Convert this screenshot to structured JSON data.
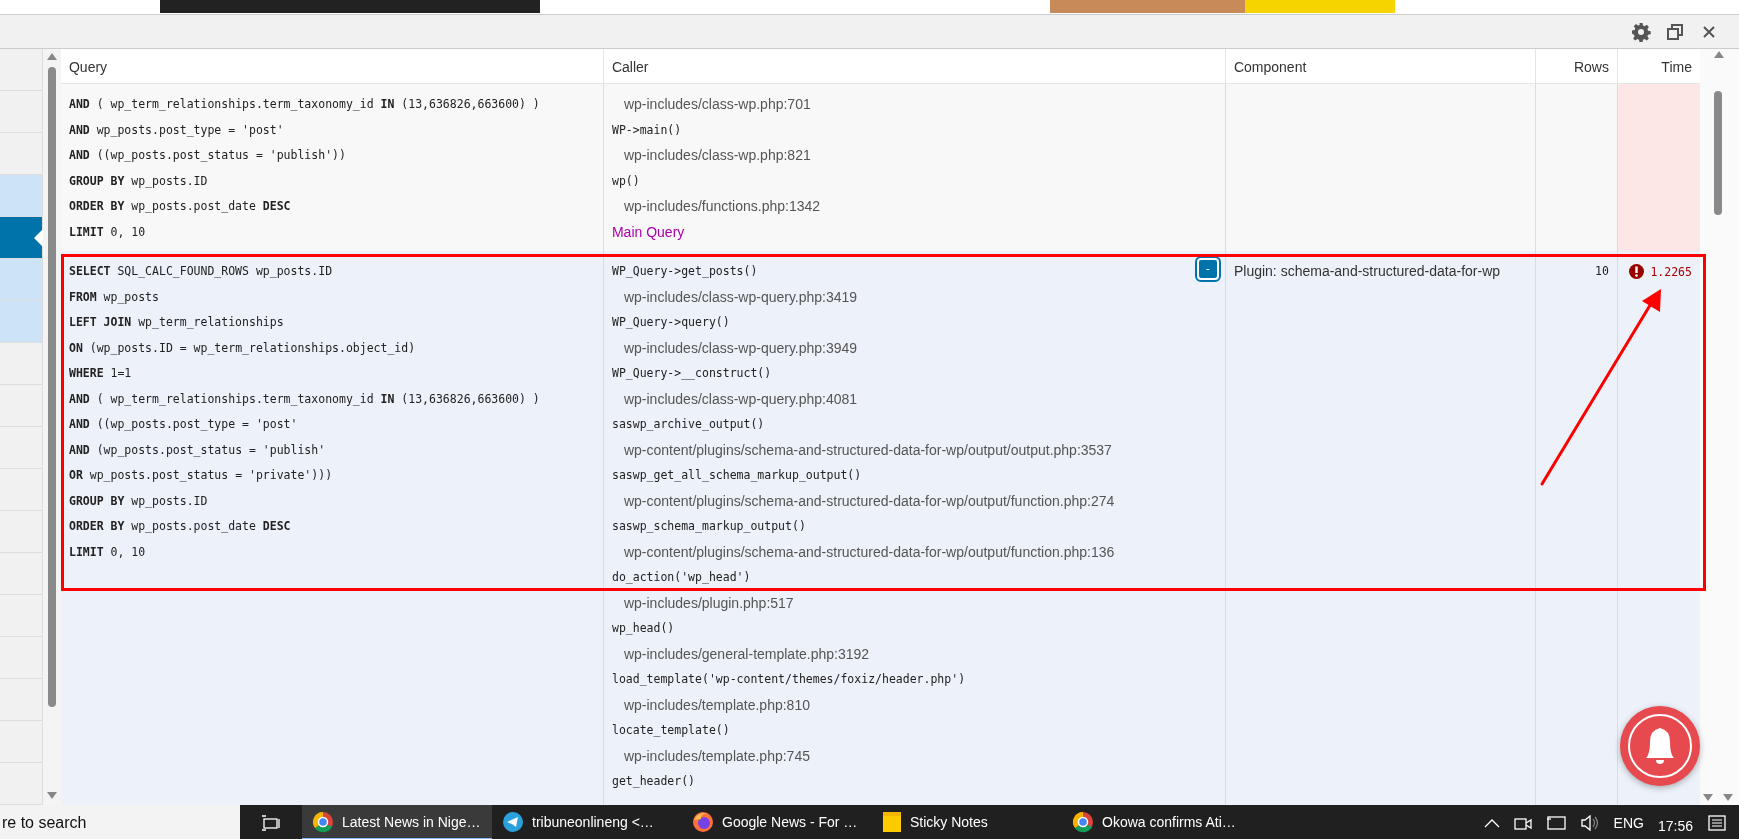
{
  "sidebar": {
    "items": [
      {
        "selected": false,
        "highlighted": false
      },
      {
        "selected": false,
        "highlighted": false
      },
      {
        "selected": false,
        "highlighted": false
      },
      {
        "selected": false,
        "highlighted": true
      },
      {
        "selected": true,
        "highlighted": false
      },
      {
        "selected": false,
        "highlighted": true
      },
      {
        "selected": false,
        "highlighted": true
      },
      {
        "selected": false,
        "highlighted": false
      },
      {
        "selected": false,
        "highlighted": false
      },
      {
        "selected": false,
        "highlighted": false
      },
      {
        "selected": false,
        "highlighted": false
      },
      {
        "selected": false,
        "highlighted": false
      },
      {
        "selected": false,
        "highlighted": false
      },
      {
        "selected": false,
        "highlighted": false
      },
      {
        "selected": false,
        "highlighted": false
      },
      {
        "selected": false,
        "highlighted": false
      },
      {
        "selected": false,
        "highlighted": false
      },
      {
        "selected": false,
        "highlighted": false
      }
    ]
  },
  "table": {
    "columns": [
      {
        "label": "Query"
      },
      {
        "label": "Caller"
      },
      {
        "label": "Component"
      },
      {
        "label": "Rows"
      },
      {
        "label": "Time"
      }
    ],
    "rows": [
      {
        "time_highlight": true,
        "time_alert": false,
        "query": [
          "**AND** ( wp_term_relationships.term_taxonomy_id **IN** (13,636826,663600) )",
          "**AND** wp_posts.post_type = 'post'",
          "**AND** ((wp_posts.post_status = 'publish'))",
          "**GROUP BY** wp_posts.ID",
          "**ORDER BY** wp_posts.post_date **DESC**",
          "**LIMIT** 0, 10"
        ],
        "caller": [
          {
            "kind": "path",
            "text": "wp-includes/class-wp.php:701"
          },
          {
            "kind": "function",
            "text": "WP->main()"
          },
          {
            "kind": "path",
            "text": "wp-includes/class-wp.php:821"
          },
          {
            "kind": "function",
            "text": "wp()"
          },
          {
            "kind": "path",
            "text": "wp-includes/functions.php:1342"
          },
          {
            "kind": "label",
            "text": "Main Query"
          }
        ]
      },
      {
        "time_highlight": false,
        "time_alert": true,
        "toggle": "-",
        "component": "Plugin: schema-and-structured-data-for-wp",
        "rows": "10",
        "time": "1.2265",
        "query": [
          "**SELECT** SQL_CALC_FOUND_ROWS wp_posts.ID",
          "**FROM** wp_posts",
          "**LEFT JOIN** wp_term_relationships",
          "**ON** (wp_posts.ID = wp_term_relationships.object_id)",
          "**WHERE** 1=1",
          "**AND** ( wp_term_relationships.term_taxonomy_id **IN** (13,636826,663600) )",
          "**AND** ((wp_posts.post_type = 'post'",
          "**AND** (wp_posts.post_status = 'publish'",
          "**OR** wp_posts.post_status = 'private')))",
          "**GROUP BY** wp_posts.ID",
          "**ORDER BY** wp_posts.post_date **DESC**",
          "**LIMIT** 0, 10"
        ],
        "caller": [
          {
            "kind": "function",
            "text": "WP_Query->get_posts()"
          },
          {
            "kind": "path",
            "text": "wp-includes/class-wp-query.php:3419"
          },
          {
            "kind": "function",
            "text": "WP_Query->query()"
          },
          {
            "kind": "path",
            "text": "wp-includes/class-wp-query.php:3949"
          },
          {
            "kind": "function",
            "text": "WP_Query->__construct()"
          },
          {
            "kind": "path",
            "text": "wp-includes/class-wp-query.php:4081"
          },
          {
            "kind": "function",
            "text": "saswp_archive_output()"
          },
          {
            "kind": "path",
            "text": "wp-content/plugins/schema-and-structured-data-for-wp/output/output.php:3537"
          },
          {
            "kind": "function",
            "text": "saswp_get_all_schema_markup_output()"
          },
          {
            "kind": "path",
            "text": "wp-content/plugins/schema-and-structured-data-for-wp/output/function.php:274"
          },
          {
            "kind": "function",
            "text": "saswp_schema_markup_output()"
          },
          {
            "kind": "path",
            "text": "wp-content/plugins/schema-and-structured-data-for-wp/output/function.php:136"
          },
          {
            "kind": "function",
            "text": "do_action('wp_head')"
          },
          {
            "kind": "path",
            "text": "wp-includes/plugin.php:517"
          },
          {
            "kind": "function",
            "text": "wp_head()"
          },
          {
            "kind": "path",
            "text": "wp-includes/general-template.php:3192"
          },
          {
            "kind": "function",
            "text": "load_template('wp-content/themes/foxiz/header.php')"
          },
          {
            "kind": "path",
            "text": "wp-includes/template.php:810"
          },
          {
            "kind": "function",
            "text": "locate_template()"
          },
          {
            "kind": "path",
            "text": "wp-includes/template.php:745"
          },
          {
            "kind": "function",
            "text": "get_header()"
          }
        ]
      }
    ]
  },
  "taskbar": {
    "search": {
      "placeholder": "re to search"
    },
    "apps": [
      {
        "kind": "chrome",
        "label": "Latest News in Nige…",
        "selected": true
      },
      {
        "kind": "telegram",
        "label": "tribuneonlineng <…",
        "selected": false
      },
      {
        "kind": "firefox",
        "label": "Google News - For …",
        "selected": false
      },
      {
        "kind": "notes",
        "label": "Sticky Notes",
        "selected": false
      },
      {
        "kind": "chrome",
        "label": "Okowa confirms Ati…",
        "selected": false
      }
    ],
    "language": "ENG",
    "time": "17:56"
  }
}
